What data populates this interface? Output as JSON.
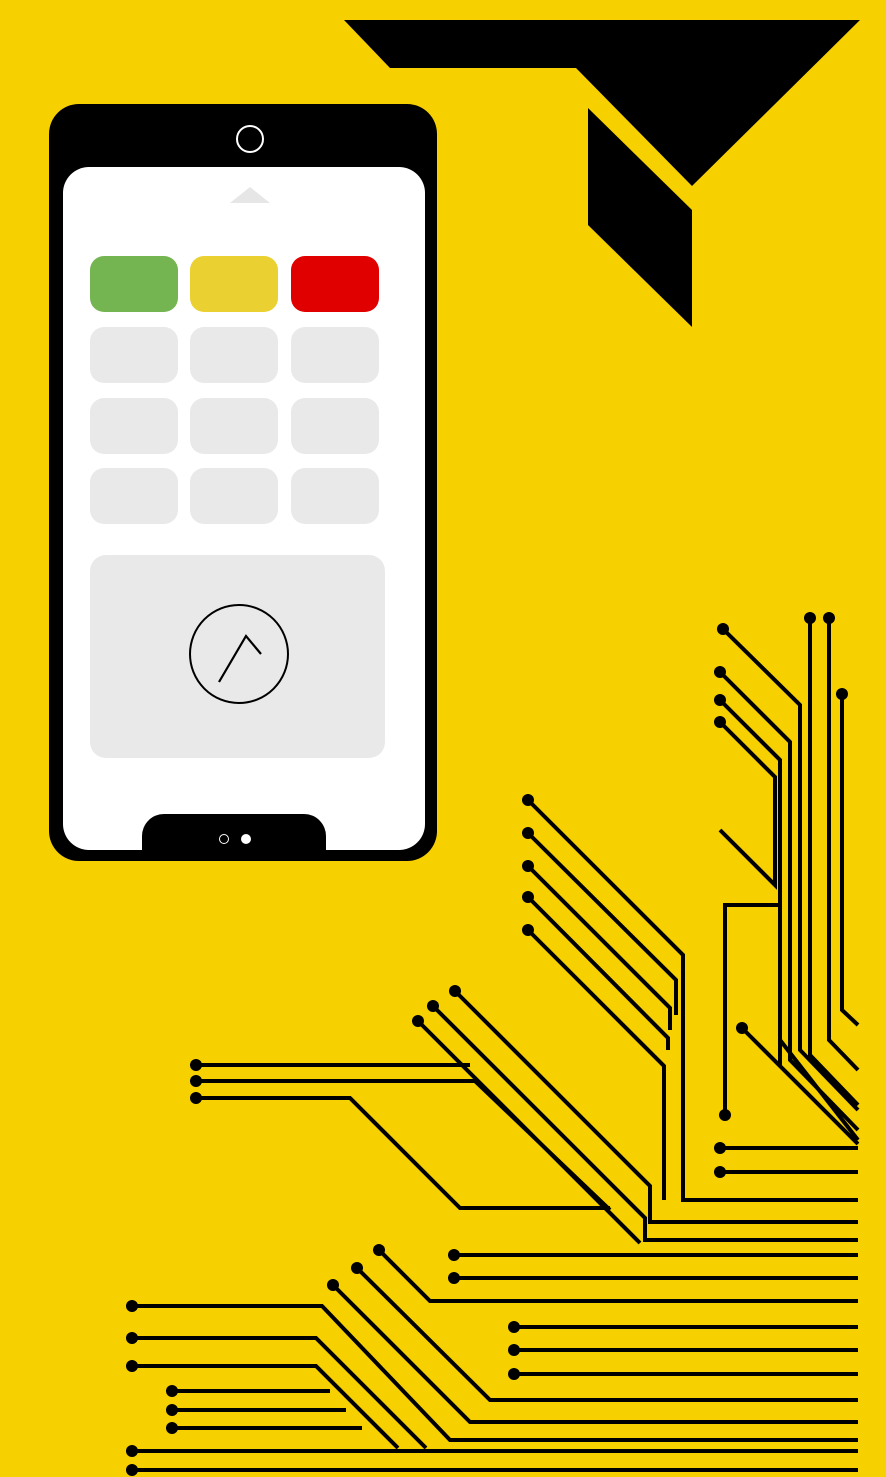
{
  "colors": {
    "background": "#f7d000",
    "phone_body": "#000000",
    "screen": "#ffffff",
    "tile": "#e9e9e9",
    "green": "#74b552",
    "yellow": "#ebd032",
    "red": "#e00000",
    "circuit": "#000000"
  },
  "phone": {
    "tiles": [
      {
        "color": "#74b552",
        "row": 0,
        "col": 0
      },
      {
        "color": "#ebd032",
        "row": 0,
        "col": 1
      },
      {
        "color": "#e00000",
        "row": 0,
        "col": 2
      },
      {
        "color": "#e9e9e9",
        "row": 1,
        "col": 0
      },
      {
        "color": "#e9e9e9",
        "row": 1,
        "col": 1
      },
      {
        "color": "#e9e9e9",
        "row": 1,
        "col": 2
      },
      {
        "color": "#e9e9e9",
        "row": 2,
        "col": 0
      },
      {
        "color": "#e9e9e9",
        "row": 2,
        "col": 1
      },
      {
        "color": "#e9e9e9",
        "row": 2,
        "col": 2
      },
      {
        "color": "#e9e9e9",
        "row": 3,
        "col": 0
      },
      {
        "color": "#e9e9e9",
        "row": 3,
        "col": 1
      },
      {
        "color": "#e9e9e9",
        "row": 3,
        "col": 2
      }
    ],
    "action_icon": "caret-up-icon",
    "pager": {
      "count": 2,
      "active": 2
    }
  },
  "logo": {
    "icon": "triangle-logo-icon"
  },
  "decor": {
    "icon": "circuit-traces-icon"
  }
}
